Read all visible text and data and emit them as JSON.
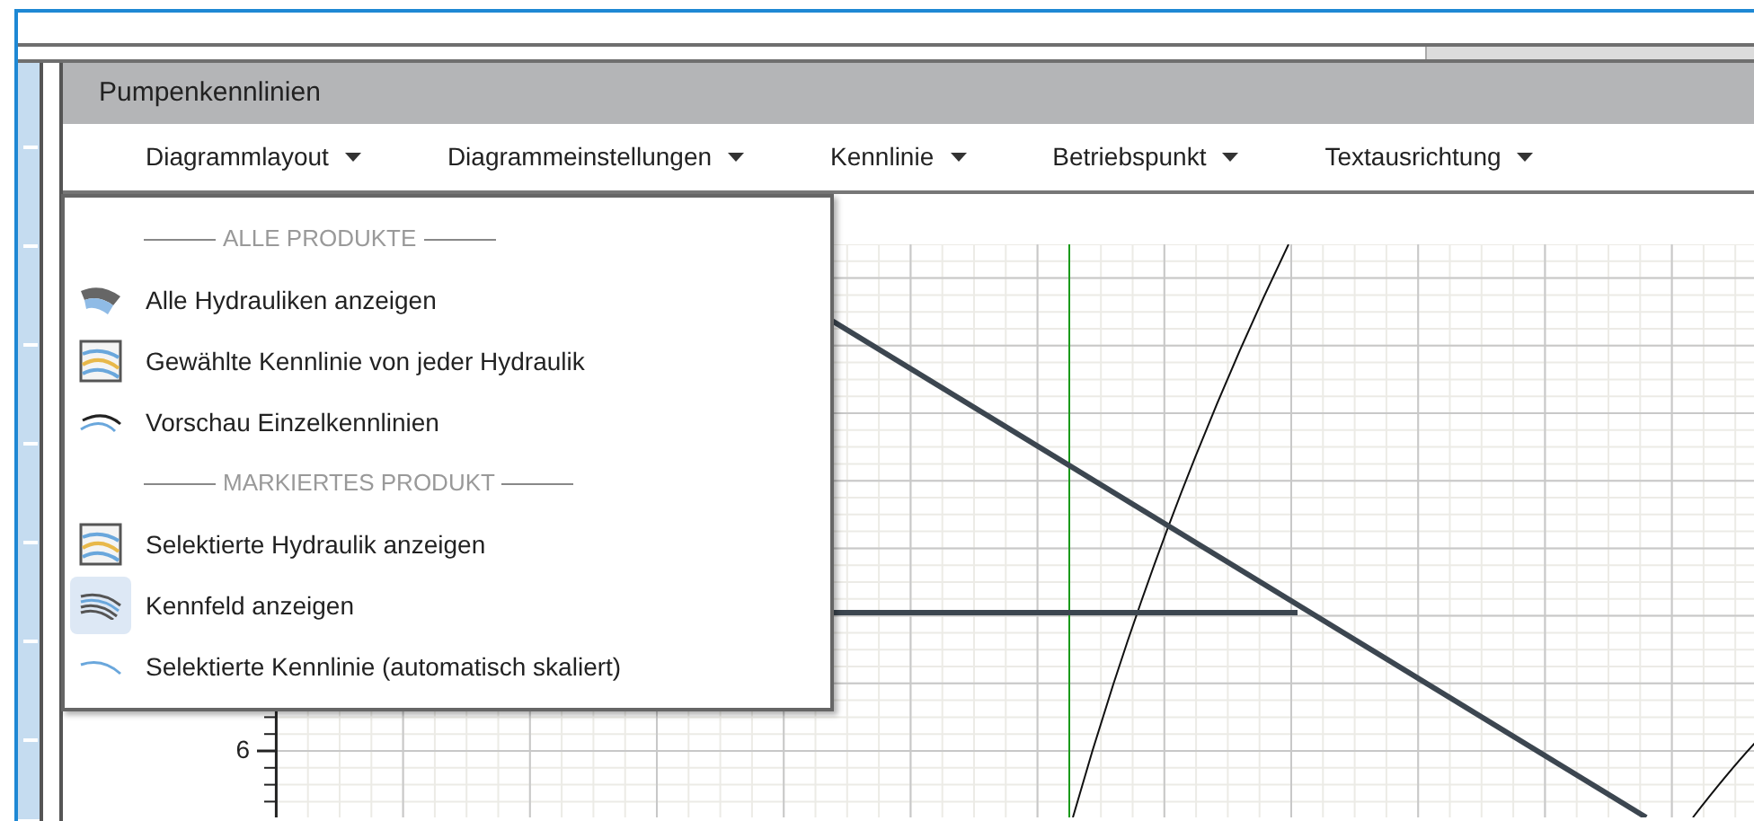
{
  "panel": {
    "title": "Pumpenkennlinien"
  },
  "menu_bar": [
    {
      "label": "Diagrammlayout"
    },
    {
      "label": "Diagrammeinstellungen"
    },
    {
      "label": "Kennlinie"
    },
    {
      "label": "Betriebspunkt"
    },
    {
      "label": "Textausrichtung"
    }
  ],
  "dropdown": {
    "sections": [
      {
        "heading": "ALLE PRODUKTE",
        "items": [
          {
            "label": "Alle Hydrauliken anzeigen",
            "kind": "fan",
            "selected": false
          },
          {
            "label": "Gewählte Kennlinie von jeder Hydraulik",
            "kind": "framed",
            "selected": false
          },
          {
            "label": "Vorschau Einzelkennlinien",
            "kind": "arcs",
            "selected": false
          }
        ]
      },
      {
        "heading": "MARKIERTES PRODUKT",
        "items": [
          {
            "label": "Selektierte Hydraulik anzeigen",
            "kind": "framed",
            "selected": false
          },
          {
            "label": "Kennfeld anzeigen",
            "kind": "multi",
            "selected": true
          },
          {
            "label": "Selektierte Kennlinie (automatisch skaliert)",
            "kind": "single",
            "selected": false
          }
        ]
      }
    ]
  },
  "chart": {
    "y_tick_labels": [
      "6"
    ]
  }
}
